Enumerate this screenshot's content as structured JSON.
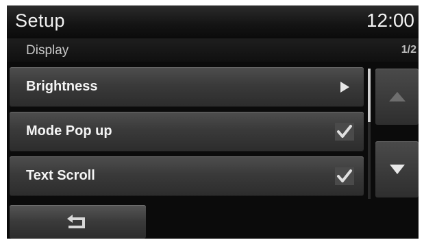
{
  "header": {
    "title": "Setup",
    "clock": "12:00"
  },
  "subheader": {
    "title": "Display",
    "page": "1/2"
  },
  "menu": {
    "items": [
      {
        "label": "Brightness",
        "indicator": "arrow-right-icon"
      },
      {
        "label": "Mode Pop up",
        "indicator": "checkmark-icon",
        "checked": true
      },
      {
        "label": "Text Scroll",
        "indicator": "checkmark-icon",
        "checked": true
      }
    ]
  },
  "scroll": {
    "up_icon": "arrow-up-icon",
    "down_icon": "arrow-down-icon",
    "up_enabled": false,
    "down_enabled": true
  },
  "footer": {
    "back_icon": "back-icon"
  },
  "colors": {
    "background": "#0b0b0b",
    "text": "#f4f4f4",
    "button": "#3a3a3a"
  }
}
